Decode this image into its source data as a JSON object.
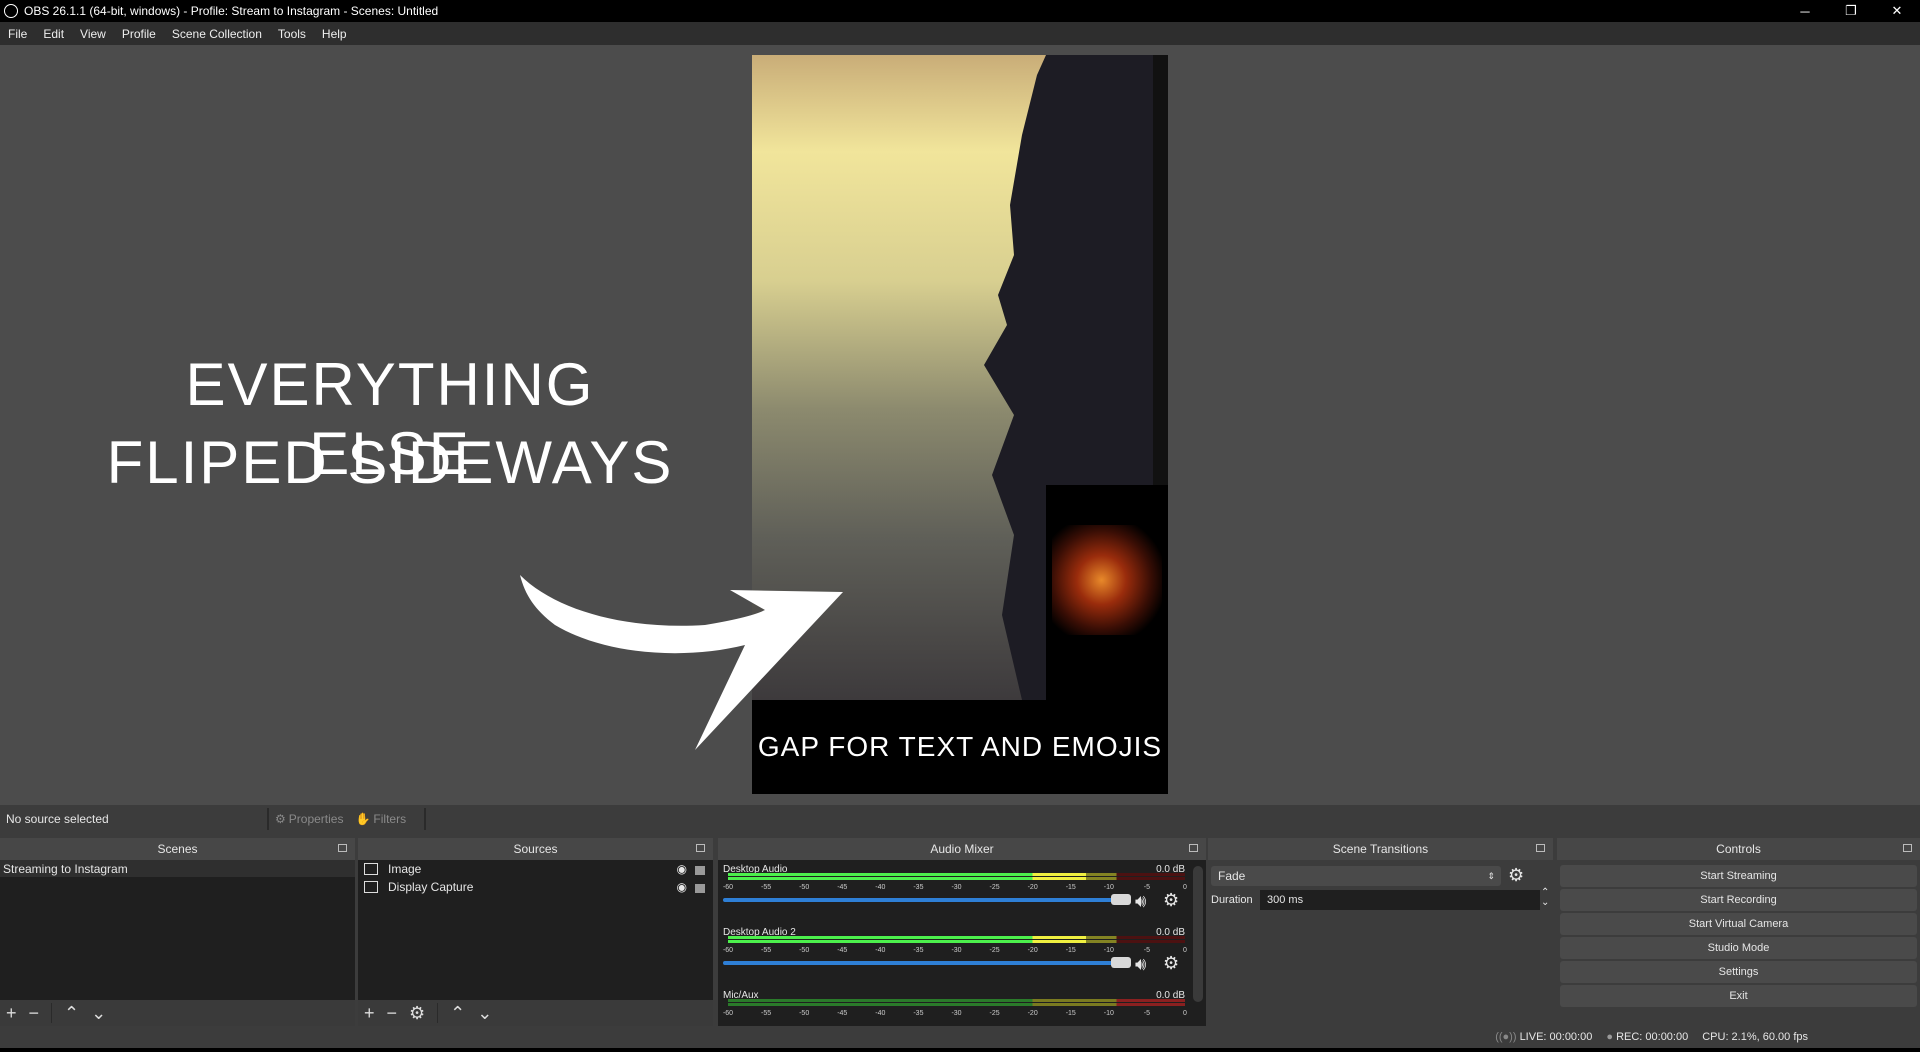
{
  "window": {
    "title": "OBS 26.1.1 (64-bit, windows) - Profile: Stream to Instagram - Scenes: Untitled",
    "minimize": "─",
    "restore": "❐",
    "close": "✕"
  },
  "menu": [
    "File",
    "Edit",
    "View",
    "Profile",
    "Scene Collection",
    "Tools",
    "Help"
  ],
  "preview": {
    "overlay_line1": "EVERYTHING ELSE",
    "overlay_line2": "FLIPED SIDEWAYS",
    "gap_text": "GAP FOR TEXT AND EMOJIS"
  },
  "source_toolbar": {
    "status": "No source selected",
    "properties": "Properties",
    "filters": "Filters"
  },
  "scenes": {
    "title": "Scenes",
    "items": [
      "Streaming to Instagram"
    ]
  },
  "sources": {
    "title": "Sources",
    "items": [
      {
        "name": "Image",
        "icon": "image-icon",
        "visible": true,
        "locked": false
      },
      {
        "name": "Display Capture",
        "icon": "monitor-icon",
        "visible": true,
        "locked": false
      }
    ]
  },
  "mixer": {
    "title": "Audio Mixer",
    "ticks": [
      "-60",
      "-55",
      "-50",
      "-45",
      "-40",
      "-35",
      "-30",
      "-25",
      "-20",
      "-15",
      "-10",
      "-5",
      "0"
    ],
    "channels": [
      {
        "name": "Desktop Audio",
        "db": "0.0 dB",
        "level_db": -13,
        "volume": 1.0,
        "active": true
      },
      {
        "name": "Desktop Audio 2",
        "db": "0.0 dB",
        "level_db": -13,
        "volume": 1.0,
        "active": true
      },
      {
        "name": "Mic/Aux",
        "db": "0.0 dB",
        "level_db": -60,
        "volume": 1.0,
        "active": false
      }
    ]
  },
  "transitions": {
    "title": "Scene Transitions",
    "selected": "Fade",
    "duration_label": "Duration",
    "duration": "300 ms"
  },
  "controls": {
    "title": "Controls",
    "buttons": [
      "Start Streaming",
      "Start Recording",
      "Start Virtual Camera",
      "Studio Mode",
      "Settings",
      "Exit"
    ]
  },
  "status": {
    "live": "LIVE: 00:00:00",
    "rec": "REC: 00:00:00",
    "cpu": "CPU: 2.1%, 60.00 fps"
  },
  "colors": {
    "meter_green": "#4cf04c",
    "meter_yellow": "#f0f040",
    "meter_red": "#8a2020",
    "volume": "#2e7fd6"
  }
}
